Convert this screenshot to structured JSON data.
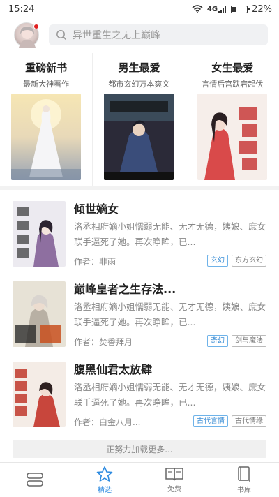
{
  "status_bar": {
    "time": "15:24",
    "signal": "4G",
    "battery": "22%",
    "battery_level": 0.22
  },
  "header": {
    "search_placeholder": "异世重生之无上巅峰"
  },
  "featured": [
    {
      "title": "重磅新书",
      "subtitle": "最新大神著作"
    },
    {
      "title": "男生最爱",
      "subtitle": "都市玄幻万本爽文"
    },
    {
      "title": "女生最爱",
      "subtitle": "言情后宫跌宕起伏"
    }
  ],
  "books": [
    {
      "title": "倾世嫡女",
      "desc": "洛丞相府嫡小姐懦弱无能、无才无德，姨娘、庶女联手逼死了她。再次睁眸，已...",
      "author": "作者：非雨",
      "tags": [
        "玄幻",
        "东方玄幻"
      ]
    },
    {
      "title": "巅峰皇者之生存法...",
      "desc": "洛丞相府嫡小姐懦弱无能、无才无德，姨娘、庶女联手逼死了她。再次睁眸，已...",
      "author": "作者：焚香拜月",
      "tags": [
        "奇幻",
        "剑与魔法"
      ]
    },
    {
      "title": "腹黑仙君太放肆",
      "desc": "洛丞相府嫡小姐懦弱无能、无才无德，姨娘、庶女联手逼死了她。再次睁眸，已...",
      "author": "作者：白金八月...",
      "tags": [
        "古代言情",
        "古代情缘"
      ]
    }
  ],
  "load_more": "正努力加载更多...",
  "tabs": [
    {
      "label": ""
    },
    {
      "label": "精选"
    },
    {
      "label": "免费"
    },
    {
      "label": "书库"
    }
  ],
  "colors": {
    "accent": "#2c8ae0",
    "notify": "#e02020"
  }
}
